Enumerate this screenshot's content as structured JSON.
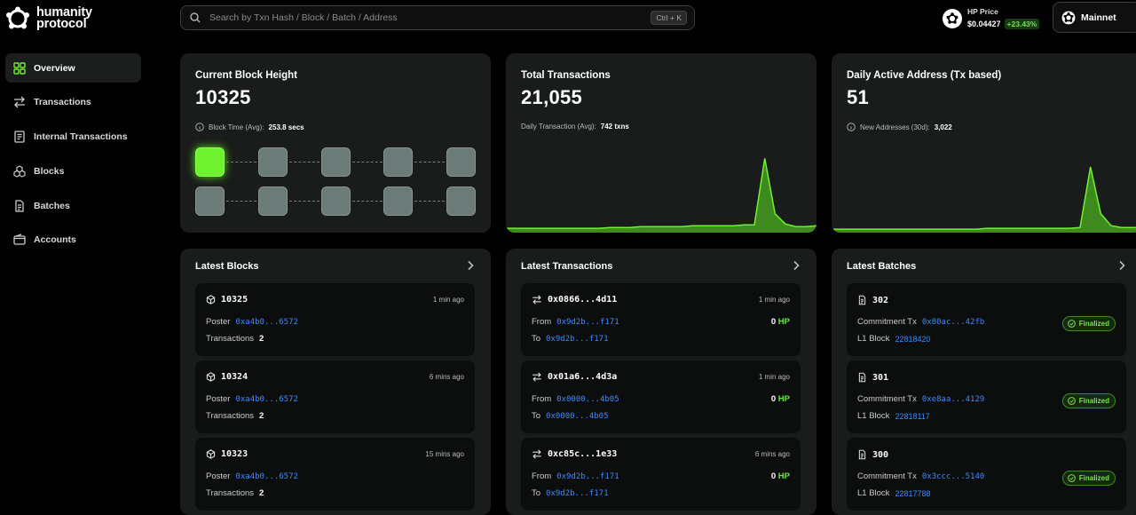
{
  "brand": {
    "line1": "humanity",
    "line2": "protocol"
  },
  "sidebar": {
    "items": [
      {
        "label": "Overview",
        "icon": "grid-icon"
      },
      {
        "label": "Transactions",
        "icon": "swap-icon"
      },
      {
        "label": "Internal Transactions",
        "icon": "receipt-icon"
      },
      {
        "label": "Blocks",
        "icon": "cubes-icon"
      },
      {
        "label": "Batches",
        "icon": "document-icon"
      },
      {
        "label": "Accounts",
        "icon": "wallet-icon"
      }
    ]
  },
  "search": {
    "placeholder": "Search by Txn Hash / Block / Batch / Address",
    "shortcut": "Ctrl + K"
  },
  "price": {
    "label": "HP Price",
    "value": "$0.04427",
    "change": "+23.43%"
  },
  "network": {
    "label": "Mainnet"
  },
  "colors": {
    "accent": "#6ef230",
    "link": "#3b8bff",
    "card": "#1a1b1b"
  },
  "stats": {
    "block_height": {
      "title": "Current Block Height",
      "value": "10325",
      "sub_label": "Block Time (Avg):",
      "sub_value": "253.8 secs"
    },
    "total_tx": {
      "title": "Total Transactions",
      "value": "21,055",
      "sub_label": "Daily Transaction (Avg):",
      "sub_value": "742 txns"
    },
    "active_addr": {
      "title": "Daily Active Address (Tx based)",
      "value": "51",
      "sub_label": "New Addresses (30d):",
      "sub_value": "3,022"
    }
  },
  "chart_data": [
    {
      "type": "area",
      "series": [
        {
          "values": [
            3,
            3,
            3,
            3,
            3,
            3,
            3,
            3,
            3,
            3,
            4,
            4,
            4,
            5,
            5,
            5,
            5,
            5,
            6,
            6,
            6,
            6,
            6,
            7,
            7,
            85,
            20,
            8,
            5,
            5,
            6
          ]
        }
      ]
    },
    {
      "type": "area",
      "series": [
        {
          "values": [
            2,
            2,
            2,
            2,
            2,
            2,
            2,
            2,
            2,
            2,
            2,
            2,
            2,
            2,
            2,
            3,
            3,
            3,
            3,
            3,
            3,
            3,
            3,
            3,
            4,
            75,
            20,
            6,
            4,
            4,
            4
          ]
        }
      ]
    }
  ],
  "latest_blocks": {
    "title": "Latest Blocks",
    "items": [
      {
        "id": "10325",
        "ago": "1 min ago",
        "poster_label": "Poster",
        "poster": "0xa4b0...6572",
        "tx_label": "Transactions",
        "tx": "2"
      },
      {
        "id": "10324",
        "ago": "6 mins ago",
        "poster_label": "Poster",
        "poster": "0xa4b0...6572",
        "tx_label": "Transactions",
        "tx": "2"
      },
      {
        "id": "10323",
        "ago": "15 mins ago",
        "poster_label": "Poster",
        "poster": "0xa4b0...6572",
        "tx_label": "Transactions",
        "tx": "2"
      }
    ]
  },
  "latest_tx": {
    "title": "Latest Transactions",
    "items": [
      {
        "hash": "0x0866...4d11",
        "ago": "1 min ago",
        "from_label": "From",
        "from": "0x9d2b...f171",
        "to_label": "To",
        "to": "0x9d2b...f171",
        "amount": "0",
        "unit": "HP"
      },
      {
        "hash": "0x01a6...4d3a",
        "ago": "1 min ago",
        "from_label": "From",
        "from": "0x0000...4b05",
        "to_label": "To",
        "to": "0x0000...4b05",
        "amount": "0",
        "unit": "HP"
      },
      {
        "hash": "0xc85c...1e33",
        "ago": "6 mins ago",
        "from_label": "From",
        "from": "0x9d2b...f171",
        "to_label": "To",
        "to": "0x9d2b...f171",
        "amount": "0",
        "unit": "HP"
      }
    ]
  },
  "latest_batches": {
    "title": "Latest Batches",
    "items": [
      {
        "id": "302",
        "commit_label": "Commitment Tx",
        "commit": "0x80ac...42fb",
        "l1_label": "L1 Block",
        "l1": "22818420",
        "status": "Finalized"
      },
      {
        "id": "301",
        "commit_label": "Commitment Tx",
        "commit": "0xe8aa...4129",
        "l1_label": "L1 Block",
        "l1": "22818117",
        "status": "Finalized"
      },
      {
        "id": "300",
        "commit_label": "Commitment Tx",
        "commit": "0x3ccc...5140",
        "l1_label": "L1 Block",
        "l1": "22817788",
        "status": "Finalized"
      }
    ]
  }
}
